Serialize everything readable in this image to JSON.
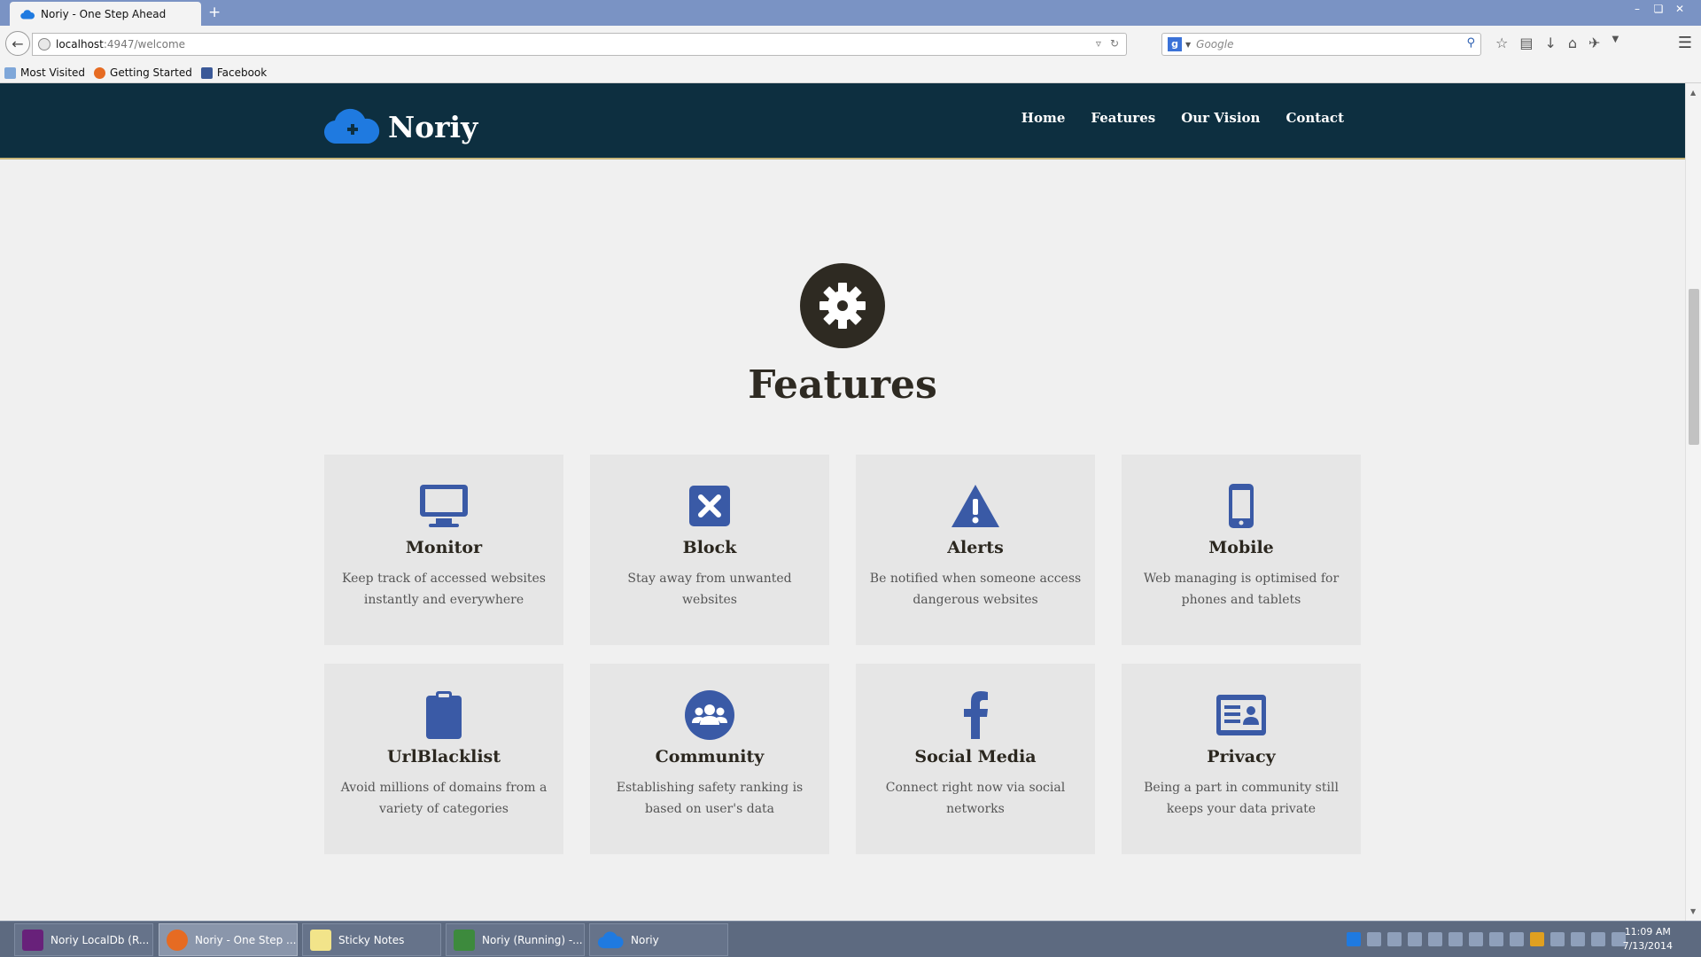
{
  "browser": {
    "tab_title": "Noriy - One Step Ahead",
    "new_tab": "+",
    "url_host": "localhost",
    "url_path": ":4947/welcome",
    "search_placeholder": "Google",
    "bookmarks": [
      "Most Visited",
      "Getting Started",
      "Facebook"
    ]
  },
  "header": {
    "brand": "Noriy",
    "nav": [
      "Home",
      "Features",
      "Our Vision",
      "Contact"
    ]
  },
  "section": {
    "title": "Features"
  },
  "features": [
    {
      "icon": "monitor-icon",
      "title": "Monitor",
      "desc": "Keep track of accessed websites instantly and everywhere"
    },
    {
      "icon": "block-icon",
      "title": "Block",
      "desc": "Stay away from unwanted websites"
    },
    {
      "icon": "warning-icon",
      "title": "Alerts",
      "desc": "Be notified when someone access dangerous websites"
    },
    {
      "icon": "mobile-icon",
      "title": "Mobile",
      "desc": "Web managing is optimised for phones and tablets"
    },
    {
      "icon": "clipboard-icon",
      "title": "UrlBlacklist",
      "desc": "Avoid millions of domains from a variety of categories"
    },
    {
      "icon": "community-icon",
      "title": "Community",
      "desc": "Establishing safety ranking is based on user's data"
    },
    {
      "icon": "facebook-icon",
      "title": "Social Media",
      "desc": "Connect right now via social networks"
    },
    {
      "icon": "id-card-icon",
      "title": "Privacy",
      "desc": "Being a part in community still keeps your data private"
    }
  ],
  "taskbar": {
    "items": [
      "Noriy LocalDb (R...",
      "Noriy - One Step ...",
      "Sticky Notes",
      "Noriy (Running) -...",
      "Noriy"
    ],
    "time": "11:09 AM",
    "date": "7/13/2014"
  },
  "colors": {
    "accent": "#3a5aa6",
    "header_bg": "#0d2f40",
    "dark": "#2e2a22"
  }
}
